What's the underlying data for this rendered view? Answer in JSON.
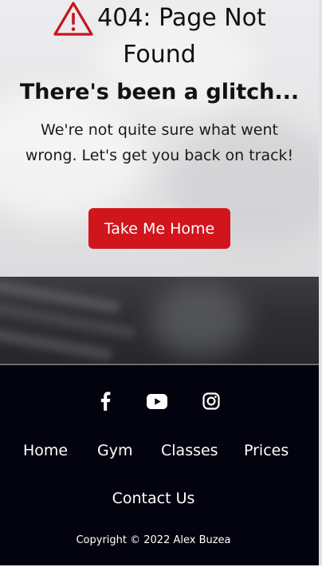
{
  "error": {
    "title_line1": "404: Page Not",
    "title_line2": "Found",
    "subtitle": "There's been a glitch...",
    "message": "We're not quite sure what went wrong. Let's get you back on track!",
    "button_label": "Take Me Home",
    "icon": "warning-triangle-icon"
  },
  "footer": {
    "socials": [
      {
        "icon": "facebook-icon"
      },
      {
        "icon": "youtube-icon"
      },
      {
        "icon": "instagram-icon"
      }
    ],
    "nav": {
      "home": "Home",
      "gym": "Gym",
      "classes": "Classes",
      "prices": "Prices",
      "contact": "Contact Us"
    },
    "copyright": "Copyright © 2022 Alex Buzea"
  },
  "colors": {
    "accent": "#d0151c",
    "footer_bg": "#03030f",
    "text": "#111111"
  }
}
